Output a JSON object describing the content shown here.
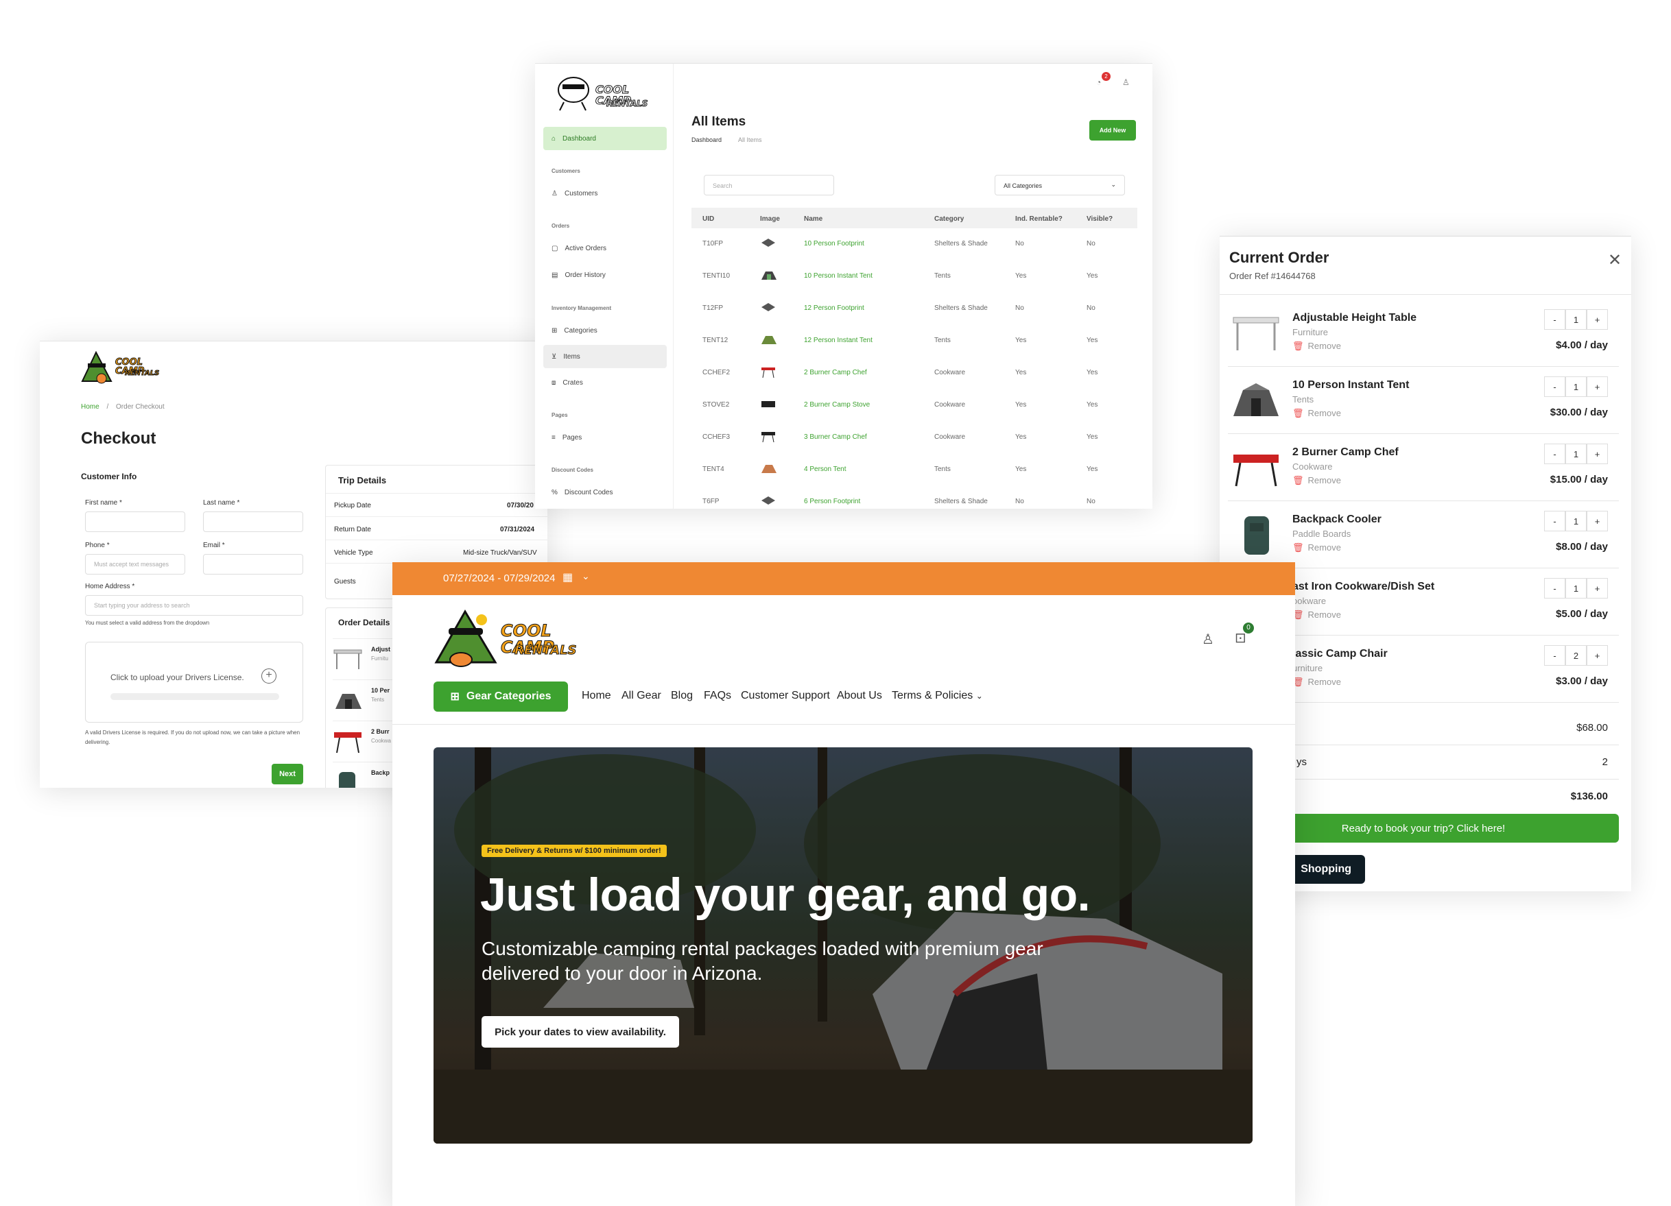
{
  "checkout": {
    "breadcrumb": [
      "Home",
      "/",
      "Order Checkout"
    ],
    "title": "Checkout",
    "customer_info": "Customer Info",
    "first_name": "First name *",
    "last_name": "Last name *",
    "phone": "Phone *",
    "email": "Email *",
    "phone_placeholder": "Must accept text messages",
    "home_address": "Home Address *",
    "address_placeholder": "Start typing your address to search",
    "address_hint": "You must select a valid address from the dropdown",
    "upload": "Click to upload your Drivers License.",
    "license_note": "A valid Drivers License is required. If you do not upload now, we can take a picture when delivering.",
    "next": "Next",
    "trip_details": "Trip Details",
    "pickup_label": "Pickup Date",
    "pickup_value": "07/30/20",
    "return_label": "Return Date",
    "return_value": "07/31/2024",
    "vehicle_label": "Vehicle Type",
    "vehicle_value": "Mid-size Truck/Van/SUV",
    "guests_label": "Guests",
    "order_details": "Order Details",
    "order_items": [
      {
        "name": "Adjust",
        "cat": "Furnitu"
      },
      {
        "name": "10 Per",
        "cat": "Tents"
      },
      {
        "name": "2 Burr",
        "cat": "Cookwa"
      },
      {
        "name": "Backp",
        "cat": ""
      }
    ]
  },
  "admin": {
    "title": "All Items",
    "breadcrumb": [
      "Dashboard",
      "All Items"
    ],
    "add_new": "Add New",
    "notif_count": "2",
    "nav": {
      "dashboard": "Dashboard",
      "sec_customers": "Customers",
      "customers": "Customers",
      "sec_orders": "Orders",
      "active_orders": "Active Orders",
      "order_history": "Order History",
      "sec_inventory": "Inventory Management",
      "categories": "Categories",
      "items": "Items",
      "crates": "Crates",
      "sec_pages": "Pages",
      "pages": "Pages",
      "sec_discount": "Discount Codes",
      "discount_codes": "Discount Codes"
    },
    "search_placeholder": "Search",
    "category_filter": "All Categories",
    "columns": [
      "UID",
      "Image",
      "Name",
      "Category",
      "Ind. Rentable?",
      "Visible?"
    ],
    "rows": [
      [
        "T10FP",
        "10 Person Footprint",
        "Shelters & Shade",
        "No",
        "No"
      ],
      [
        "TENTI10",
        "10 Person Instant Tent",
        "Tents",
        "Yes",
        "Yes"
      ],
      [
        "T12FP",
        "12 Person Footprint",
        "Shelters & Shade",
        "No",
        "No"
      ],
      [
        "TENT12",
        "12 Person Instant Tent",
        "Tents",
        "Yes",
        "Yes"
      ],
      [
        "CCHEF2",
        "2 Burner Camp Chef",
        "Cookware",
        "Yes",
        "Yes"
      ],
      [
        "STOVE2",
        "2 Burner Camp Stove",
        "Cookware",
        "Yes",
        "Yes"
      ],
      [
        "CCHEF3",
        "3 Burner Camp Chef",
        "Cookware",
        "Yes",
        "Yes"
      ],
      [
        "TENT4",
        "4 Person Tent",
        "Tents",
        "Yes",
        "Yes"
      ],
      [
        "T6FP",
        "6 Person Footprint",
        "Shelters & Shade",
        "No",
        "No"
      ]
    ]
  },
  "cart": {
    "title": "Current Order",
    "ref": "Order Ref #14644768",
    "items": [
      {
        "name": "Adjustable Height Table",
        "cat": "Furniture",
        "qty": "1",
        "price": "$4.00 / day"
      },
      {
        "name": "10 Person Instant Tent",
        "cat": "Tents",
        "qty": "1",
        "price": "$30.00 / day"
      },
      {
        "name": "2 Burner Camp Chef",
        "cat": "Cookware",
        "qty": "1",
        "price": "$15.00 / day"
      },
      {
        "name": "Backpack Cooler",
        "cat": "Paddle Boards",
        "qty": "1",
        "price": "$8.00 / day"
      },
      {
        "name": "ast Iron Cookware/Dish Set",
        "cat": "ookware",
        "qty": "1",
        "price": "$5.00 / day"
      },
      {
        "name": "lassic Camp Chair",
        "cat": "urniture",
        "qty": "2",
        "price": "$3.00 / day"
      }
    ],
    "remove": "Remove",
    "minus": "-",
    "plus": "+",
    "subtotal": "$68.00",
    "days_label": "ys",
    "days": "2",
    "total": "$136.00",
    "book": "Ready to book your trip? Click here!",
    "shopping": "Shopping"
  },
  "home": {
    "date_range": "07/27/2024 - 07/29/2024",
    "cart_count": "0",
    "gear_categories": "Gear Categories",
    "menu": [
      "Home",
      "All Gear",
      "Blog",
      "FAQs",
      "Customer Support",
      "About Us",
      "Terms & Policies"
    ],
    "badge": "Free Delivery & Returns w/ $100 minimum order!",
    "headline": "Just load your gear, and go.",
    "subhead": "Customizable camping rental packages loaded with premium gear delivered to your door in Arizona.",
    "cta": "Pick your dates to view availability."
  },
  "logo": {
    "line1": "COOL CAMP",
    "line2": "RENTALS"
  },
  "colors": {
    "brand_green": "#3da22f",
    "orange": "#ef8833",
    "dark": "#111"
  }
}
